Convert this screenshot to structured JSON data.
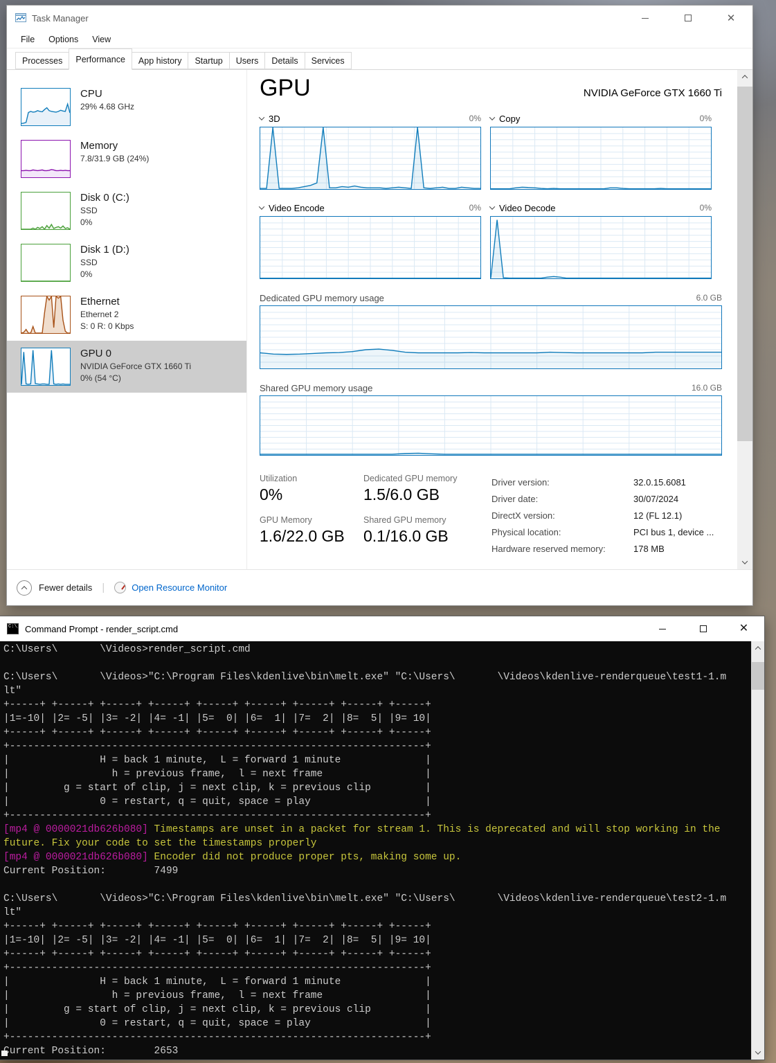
{
  "task_manager": {
    "title": "Task Manager",
    "menu": [
      "File",
      "Options",
      "View"
    ],
    "tabs": [
      "Processes",
      "Performance",
      "App history",
      "Startup",
      "Users",
      "Details",
      "Services"
    ],
    "sidebar": [
      {
        "title": "CPU",
        "lines": [
          "29%  4.68 GHz"
        ],
        "chart": {
          "points": [
            5,
            6,
            8,
            35,
            38,
            36,
            37,
            40,
            38,
            37,
            43,
            48,
            40,
            38,
            37,
            36,
            38,
            41,
            39,
            38,
            58,
            34
          ],
          "color": "#117dbb",
          "fill": "#e8f1f9",
          "border": true
        }
      },
      {
        "title": "Memory",
        "lines": [
          "7.8/31.9 GB (24%)"
        ],
        "chart": {
          "points": [
            18,
            18,
            19,
            18,
            18,
            20,
            19,
            18,
            19,
            20,
            18,
            18,
            19,
            21,
            20,
            18,
            18,
            19,
            18,
            19,
            18,
            18
          ],
          "color": "#8b12ae",
          "fill": "#f3e7f9",
          "border": true
        }
      },
      {
        "title": "Disk 0 (C:)",
        "lines": [
          "SSD",
          "0%"
        ],
        "chart": {
          "points": [
            0,
            0,
            0,
            0,
            0,
            3,
            0,
            5,
            2,
            7,
            0,
            10,
            3,
            13,
            2,
            5,
            7,
            3,
            9,
            2,
            4,
            0
          ],
          "color": "#4aa03a",
          "fill": "#eaf4e6",
          "border": true
        }
      },
      {
        "title": "Disk 1 (D:)",
        "lines": [
          "SSD",
          "0%"
        ],
        "chart": {
          "points": [
            0,
            0
          ],
          "color": "#4aa03a",
          "fill": "#ffffff",
          "border": true
        }
      },
      {
        "title": "Ethernet",
        "lines": [
          "Ethernet 2",
          "S: 0 R: 0 Kbps"
        ],
        "chart": {
          "points": [
            0,
            2,
            10,
            0,
            0,
            18,
            0,
            0,
            0,
            0,
            55,
            100,
            90,
            100,
            15,
            100,
            95,
            100,
            35,
            5,
            0,
            0
          ],
          "color": "#a75117",
          "fill": "#f0ddcd",
          "border": true
        }
      },
      {
        "title": "GPU 0",
        "lines": [
          "NVIDIA GeForce GTX 1660 Ti",
          "0%  (54 °C)"
        ],
        "selected": true,
        "chart": {
          "points": [
            2,
            90,
            3,
            2,
            3,
            95,
            4,
            3,
            2,
            3,
            3,
            2,
            2,
            95,
            3,
            2,
            3,
            2,
            3,
            2,
            2,
            2
          ],
          "color": "#117dbb",
          "fill": "#e8f1f9",
          "border": true
        }
      }
    ],
    "gpu": {
      "heading": "GPU",
      "device": "NVIDIA GeForce GTX 1660 Ti",
      "charts": [
        {
          "label": "3D",
          "value": "0%",
          "chart": {
            "grid": "#dbe9f4",
            "color": "#117dbb",
            "fill": "rgba(17,125,187,0.10)",
            "points": [
              1,
              1,
              100,
              1,
              1,
              1,
              2,
              4,
              6,
              10,
              100,
              2,
              2,
              4,
              3,
              5,
              3,
              2,
              2,
              2,
              1,
              2,
              3,
              2,
              1,
              100,
              2,
              1,
              2,
              3,
              1,
              1,
              3,
              2,
              1,
              1
            ]
          }
        },
        {
          "label": "Copy",
          "value": "0%",
          "chart": {
            "grid": "#dbe9f4",
            "color": "#117dbb",
            "fill": "rgba(17,125,187,0.10)",
            "points": [
              0.5,
              0.5,
              0.5,
              0.5,
              2,
              3,
              2.5,
              2,
              1,
              0.5,
              1,
              0.5,
              0.5,
              0.5,
              0.5,
              0.5,
              0.5,
              0.5,
              0.5,
              2,
              2,
              1,
              0.5,
              0.5,
              0.5,
              0.5,
              0.5,
              1,
              0.5,
              0.5,
              0.5,
              0.5,
              0.5,
              0.5,
              0.5,
              0.5
            ]
          }
        },
        {
          "label": "Video Encode",
          "value": "0%",
          "chart": {
            "grid": "#dbe9f4",
            "color": "#117dbb",
            "fill": "rgba(17,125,187,0.10)",
            "points": [
              0.4,
              0.4
            ]
          }
        },
        {
          "label": "Video Decode",
          "value": "0%",
          "chart": {
            "grid": "#dbe9f4",
            "color": "#117dbb",
            "fill": "rgba(17,125,187,0.10)",
            "points": [
              0.5,
              95,
              1,
              0.5,
              0.5,
              0.5,
              0.5,
              0.5,
              0.5,
              2,
              3,
              2,
              0.5,
              0.5,
              0.5,
              0.5,
              0.5,
              0.5,
              0.5,
              0.5,
              0.5,
              0.5,
              0.5,
              0.5,
              0.5,
              0.5,
              0.5,
              0.5,
              0.5,
              0.5,
              0.5,
              0.5,
              0.5,
              0.5,
              0.5,
              0.5
            ]
          }
        }
      ],
      "mem_charts": [
        {
          "label": "Dedicated GPU memory usage",
          "max": "6.0 GB",
          "chart": {
            "grid": "#dbe9f4",
            "color": "#117dbb",
            "fill": "rgba(17,125,187,0.08)",
            "points": [
              25,
              23,
              22.5,
              23,
              24,
              25,
              25.5,
              27,
              30,
              31,
              29,
              26,
              25,
              25,
              25,
              25,
              25.5,
              25,
              25,
              25,
              25,
              25,
              26,
              25.5,
              25,
              25,
              25,
              25,
              25,
              25,
              26,
              26,
              26,
              26,
              26,
              26
            ]
          }
        },
        {
          "label": "Shared GPU memory usage",
          "max": "16.0 GB",
          "chart": {
            "grid": "#dbe9f4",
            "color": "#117dbb",
            "fill": "rgba(17,125,187,0.08)",
            "points": [
              1.2,
              1.2,
              1.2,
              1.2,
              1.2,
              1.2,
              1.2,
              1.2,
              1.2,
              1.2,
              1.2,
              2.5,
              3,
              2,
              1.2,
              1.2,
              1.2,
              1.2,
              1.2,
              1.2,
              1.2,
              1.2,
              1.2,
              1.2,
              1.2,
              1.2,
              1.2,
              1.2,
              1.2,
              1.2,
              1.2,
              1.2,
              1.2,
              1.2,
              1.2,
              1.2
            ]
          }
        }
      ],
      "stats": [
        {
          "label": "Utilization",
          "value": "0%"
        },
        {
          "label": "Dedicated GPU memory",
          "value": "1.5/6.0 GB"
        },
        {
          "label": "GPU Memory",
          "value": "1.6/22.0 GB"
        },
        {
          "label": "Shared GPU memory",
          "value": "0.1/16.0 GB"
        }
      ],
      "info": [
        {
          "label": "Driver version:",
          "value": "32.0.15.6081"
        },
        {
          "label": "Driver date:",
          "value": "30/07/2024"
        },
        {
          "label": "DirectX version:",
          "value": "12 (FL 12.1)"
        },
        {
          "label": "Physical location:",
          "value": "PCI bus 1, device ..."
        },
        {
          "label": "Hardware reserved memory:",
          "value": "178 MB"
        }
      ]
    },
    "footer": {
      "fewer_details": "Fewer details",
      "open_resource_monitor": "Open Resource Monitor"
    }
  },
  "cmd": {
    "title": "Command Prompt - render_script.cmd",
    "icon_text": "C:\\_",
    "colors": {
      "background": "#0c0c0c",
      "text": "#cccccc",
      "magenta": "#bc1ca0",
      "yellow": "#c8c63c"
    },
    "lines": [
      [
        {
          "t": "C:\\Users\\       \\Videos>render_script.cmd"
        }
      ],
      [],
      [
        {
          "t": "C:\\Users\\       \\Videos>\"C:\\Program Files\\kdenlive\\bin\\melt.exe\" \"C:\\Users\\       \\Videos\\kdenlive-renderqueue\\test1-1.m"
        }
      ],
      [
        {
          "t": "lt\""
        }
      ],
      [
        {
          "t": "+-----+ +-----+ +-----+ +-----+ +-----+ +-----+ +-----+ +-----+ +-----+"
        }
      ],
      [
        {
          "t": "|1=-10| |2= -5| |3= -2| |4= -1| |5=  0| |6=  1| |7=  2| |8=  5| |9= 10|"
        }
      ],
      [
        {
          "t": "+-----+ +-----+ +-----+ +-----+ +-----+ +-----+ +-----+ +-----+ +-----+"
        }
      ],
      [
        {
          "t": "+---------------------------------------------------------------------+"
        }
      ],
      [
        {
          "t": "|               H = back 1 minute,  L = forward 1 minute              |"
        }
      ],
      [
        {
          "t": "|                 h = previous frame,  l = next frame                 |"
        }
      ],
      [
        {
          "t": "|         g = start of clip, j = next clip, k = previous clip         |"
        }
      ],
      [
        {
          "t": "|               0 = restart, q = quit, space = play                   |"
        }
      ],
      [
        {
          "t": "+---------------------------------------------------------------------+"
        }
      ],
      [
        {
          "t": "[mp4 @ 0000021db626b080] ",
          "c": "m"
        },
        {
          "t": "Timestamps are unset in a packet for stream 1. This is deprecated and will stop working in the",
          "c": "y"
        }
      ],
      [
        {
          "t": "future. Fix your code to set the timestamps properly",
          "c": "y"
        }
      ],
      [
        {
          "t": "[mp4 @ 0000021db626b080] ",
          "c": "m"
        },
        {
          "t": "Encoder did not produce proper pts, making some up.",
          "c": "y"
        }
      ],
      [
        {
          "t": "Current Position:        7499"
        }
      ],
      [],
      [
        {
          "t": "C:\\Users\\       \\Videos>\"C:\\Program Files\\kdenlive\\bin\\melt.exe\" \"C:\\Users\\       \\Videos\\kdenlive-renderqueue\\test2-1.m"
        }
      ],
      [
        {
          "t": "lt\""
        }
      ],
      [
        {
          "t": "+-----+ +-----+ +-----+ +-----+ +-----+ +-----+ +-----+ +-----+ +-----+"
        }
      ],
      [
        {
          "t": "|1=-10| |2= -5| |3= -2| |4= -1| |5=  0| |6=  1| |7=  2| |8=  5| |9= 10|"
        }
      ],
      [
        {
          "t": "+-----+ +-----+ +-----+ +-----+ +-----+ +-----+ +-----+ +-----+ +-----+"
        }
      ],
      [
        {
          "t": "+---------------------------------------------------------------------+"
        }
      ],
      [
        {
          "t": "|               H = back 1 minute,  L = forward 1 minute              |"
        }
      ],
      [
        {
          "t": "|                 h = previous frame,  l = next frame                 |"
        }
      ],
      [
        {
          "t": "|         g = start of clip, j = next clip, k = previous clip         |"
        }
      ],
      [
        {
          "t": "|               0 = restart, q = quit, space = play                   |"
        }
      ],
      [
        {
          "t": "+---------------------------------------------------------------------+"
        }
      ],
      [
        {
          "t": "Current Position:        2653"
        }
      ]
    ]
  }
}
